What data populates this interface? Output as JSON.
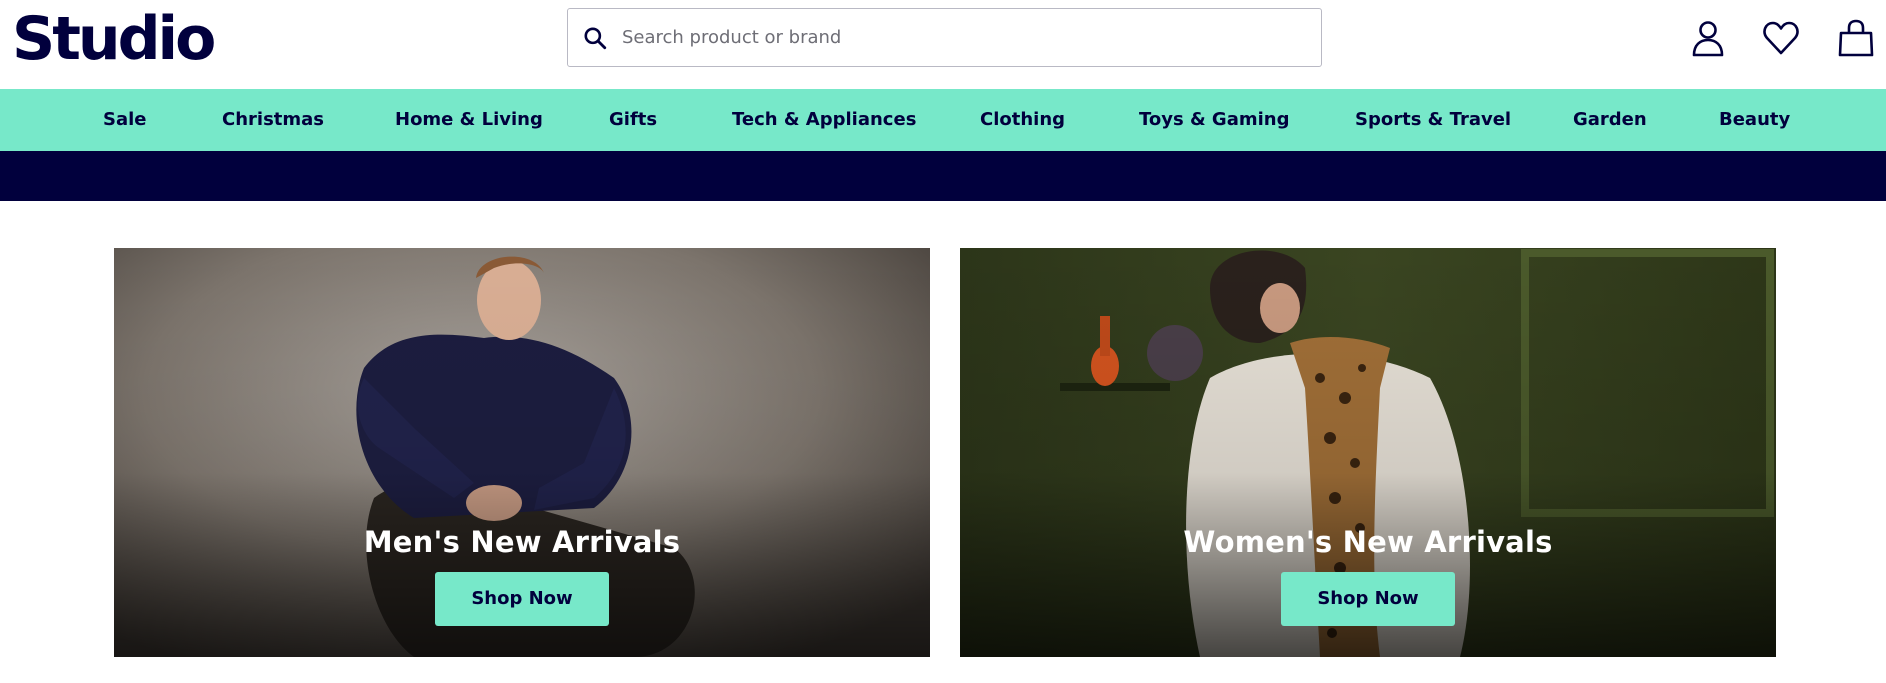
{
  "brand": {
    "logo_text": "Studio"
  },
  "search": {
    "placeholder": "Search product or brand",
    "value": ""
  },
  "header_icons": [
    "account-icon",
    "heart-icon",
    "shopping-bag-icon"
  ],
  "nav": {
    "items": [
      {
        "label": "Sale"
      },
      {
        "label": "Christmas"
      },
      {
        "label": "Home & Living"
      },
      {
        "label": "Gifts"
      },
      {
        "label": "Tech & Appliances"
      },
      {
        "label": "Clothing"
      },
      {
        "label": "Toys & Gaming"
      },
      {
        "label": "Sports & Travel"
      },
      {
        "label": "Garden"
      },
      {
        "label": "Beauty"
      }
    ]
  },
  "hero": {
    "cards": [
      {
        "title": "Men's New Arrivals",
        "button": "Shop Now"
      },
      {
        "title": "Women's New Arrivals",
        "button": "Shop Now"
      }
    ]
  },
  "colors": {
    "navy": "#01003d",
    "mint": "#77e8c9",
    "white": "#ffffff"
  }
}
